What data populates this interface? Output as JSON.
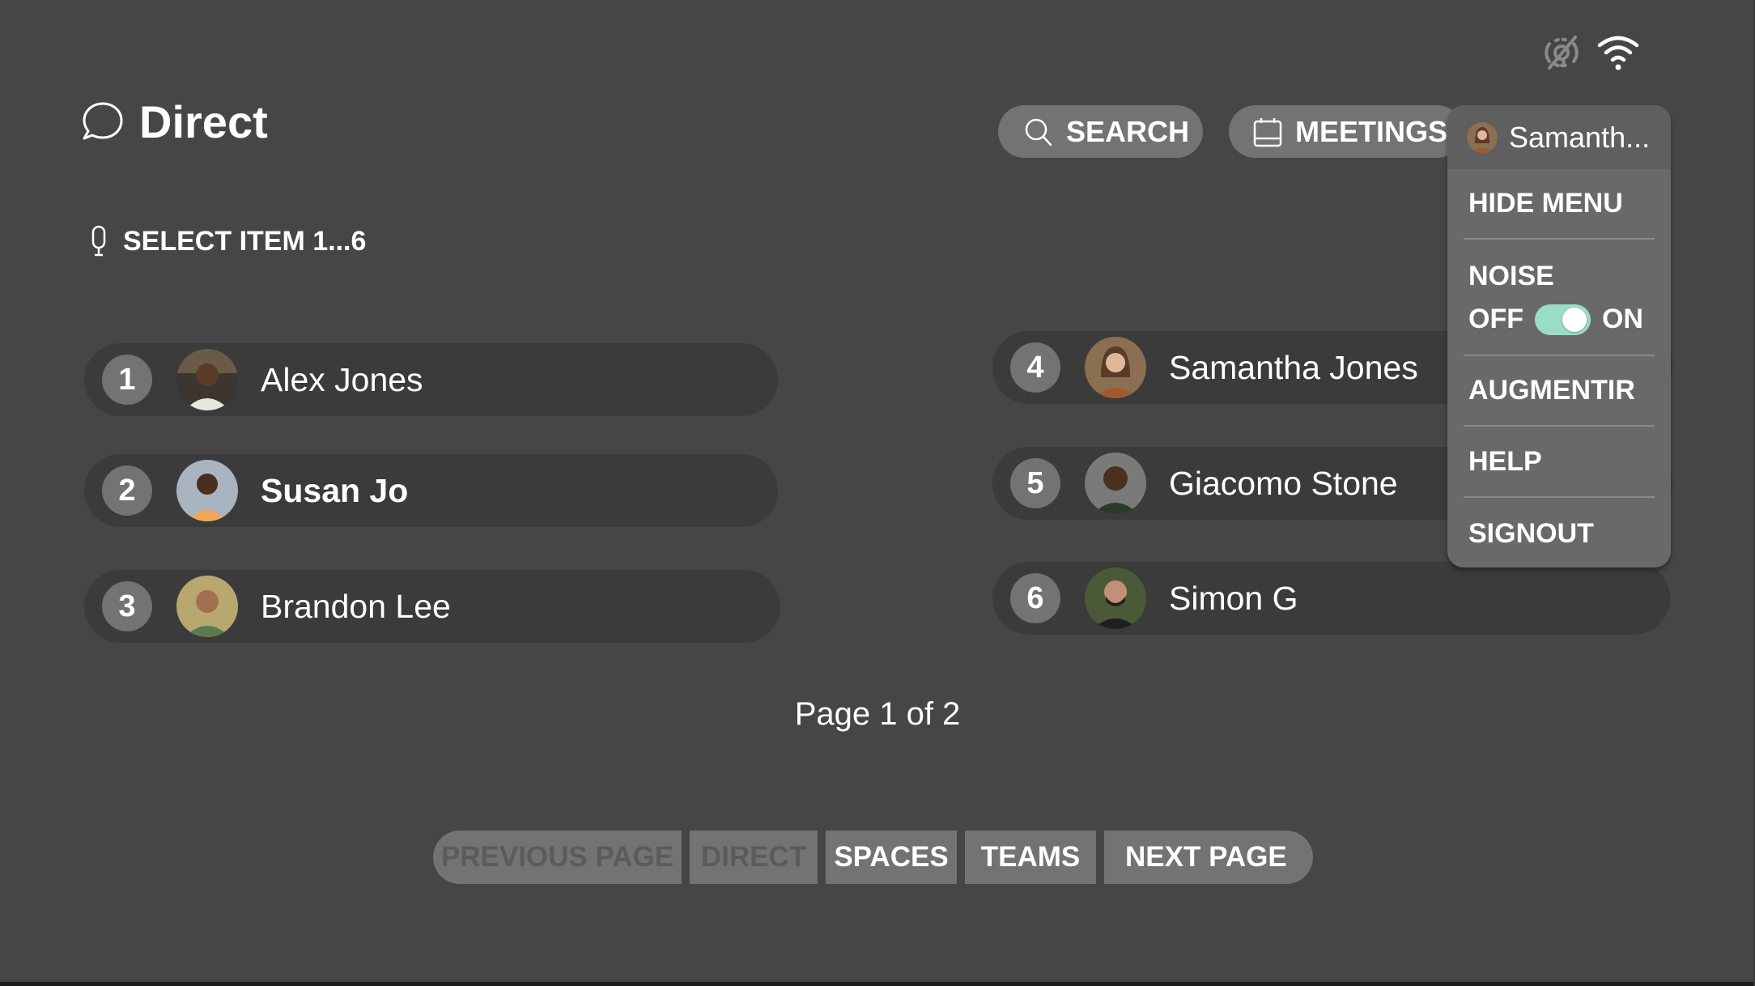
{
  "status_bar": {
    "icons": [
      "camera-off-icon",
      "wifi-icon"
    ]
  },
  "header": {
    "title": "Direct",
    "title_icon": "chat-bubble-icon",
    "voice_hint": "SELECT ITEM 1...6",
    "voice_hint_icon": "microphone-icon"
  },
  "toolbar": {
    "search_label": "SEARCH",
    "meetings_label": "MEETINGS"
  },
  "contacts": [
    {
      "number": "1",
      "name": "Alex Jones"
    },
    {
      "number": "2",
      "name": "Susan Jo"
    },
    {
      "number": "3",
      "name": "Brandon Lee"
    },
    {
      "number": "4",
      "name": "Samantha Jones"
    },
    {
      "number": "5",
      "name": "Giacomo Stone"
    },
    {
      "number": "6",
      "name": "Simon G"
    }
  ],
  "pagination": {
    "label": "Page 1 of 2",
    "current_page": 1,
    "total_pages": 2
  },
  "bottom_nav": {
    "previous_label": "PREVIOUS PAGE",
    "direct_label": "DIRECT",
    "spaces_label": "SPACES",
    "teams_label": "TEAMS",
    "next_label": "NEXT PAGE"
  },
  "user_menu": {
    "user_name": "Samanth...",
    "hide_menu_label": "HIDE MENU",
    "noise_label": "NOISE",
    "noise_off_label": "OFF",
    "noise_on_label": "ON",
    "noise_enabled": true,
    "augmentir_label": "AUGMENTIR",
    "help_label": "HELP",
    "signout_label": "SIGNOUT"
  },
  "colors": {
    "background": "#464646",
    "row_background": "#3b3b3b",
    "button_background": "#737373",
    "menu_background": "#696969",
    "toggle_on": "#99dcc8"
  }
}
